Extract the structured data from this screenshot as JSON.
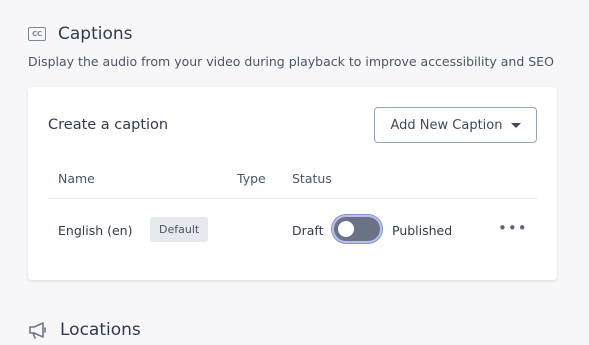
{
  "captions_section": {
    "icon": "cc-icon",
    "icon_text": "CC",
    "title": "Captions",
    "description": "Display the audio from your video during playback to improve accessibility and SEO"
  },
  "card": {
    "title": "Create a caption",
    "add_button_label": "Add New Caption",
    "columns": {
      "name": "Name",
      "type": "Type",
      "status": "Status"
    },
    "rows": [
      {
        "name": "English (en)",
        "badge": "Default",
        "status_off_label": "Draft",
        "status_on_label": "Published",
        "published": false,
        "more": "•••"
      }
    ]
  },
  "locations_section": {
    "icon": "megaphone-icon",
    "title": "Locations"
  }
}
